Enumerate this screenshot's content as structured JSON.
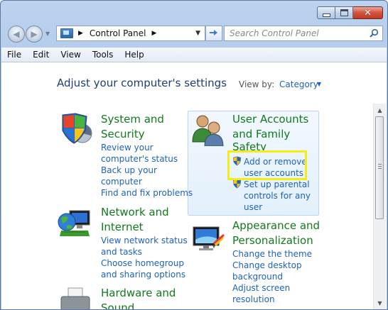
{
  "window": {
    "minimize_icon": "minimize-icon",
    "maximize_icon": "maximize-icon",
    "close_icon": "close-icon"
  },
  "nav": {
    "back_icon": "back-arrow-icon",
    "forward_icon": "forward-arrow-icon",
    "breadcrumb": "Control Panel",
    "search_placeholder": "Search Control Panel"
  },
  "menu": [
    "File",
    "Edit",
    "View",
    "Tools",
    "Help"
  ],
  "main": {
    "heading": "Adjust your computer's settings",
    "view_by_label": "View by:",
    "view_by_value": "Category",
    "categories": [
      {
        "title_line1": "System and",
        "title_line2": "Security",
        "links": [
          "Review your",
          "computer's status",
          "Back up your",
          "computer",
          "Find and fix problems"
        ]
      },
      {
        "title_line1": "Network and",
        "title_line2": "Internet",
        "links": [
          "View network status",
          "and tasks",
          "Choose homegroup",
          "and sharing options"
        ]
      },
      {
        "title_line1": "Hardware and",
        "title_line2": "Sound"
      },
      {
        "title_line1": "User Accounts",
        "title_line2": "and Family",
        "title_line3": "Safety",
        "links": [
          "Add or remove",
          "user accounts",
          "Set up parental",
          "controls for any",
          "user"
        ]
      },
      {
        "title_line1": "Appearance and",
        "title_line2": "Personalization",
        "links": [
          "Change the theme",
          "Change desktop",
          "background",
          "Adjust screen",
          "resolution"
        ]
      }
    ]
  },
  "colors": {
    "category_title": "#117a1d",
    "link": "#1c63b7",
    "heading": "#1e3d78",
    "highlight_box": "#f2ee12"
  }
}
